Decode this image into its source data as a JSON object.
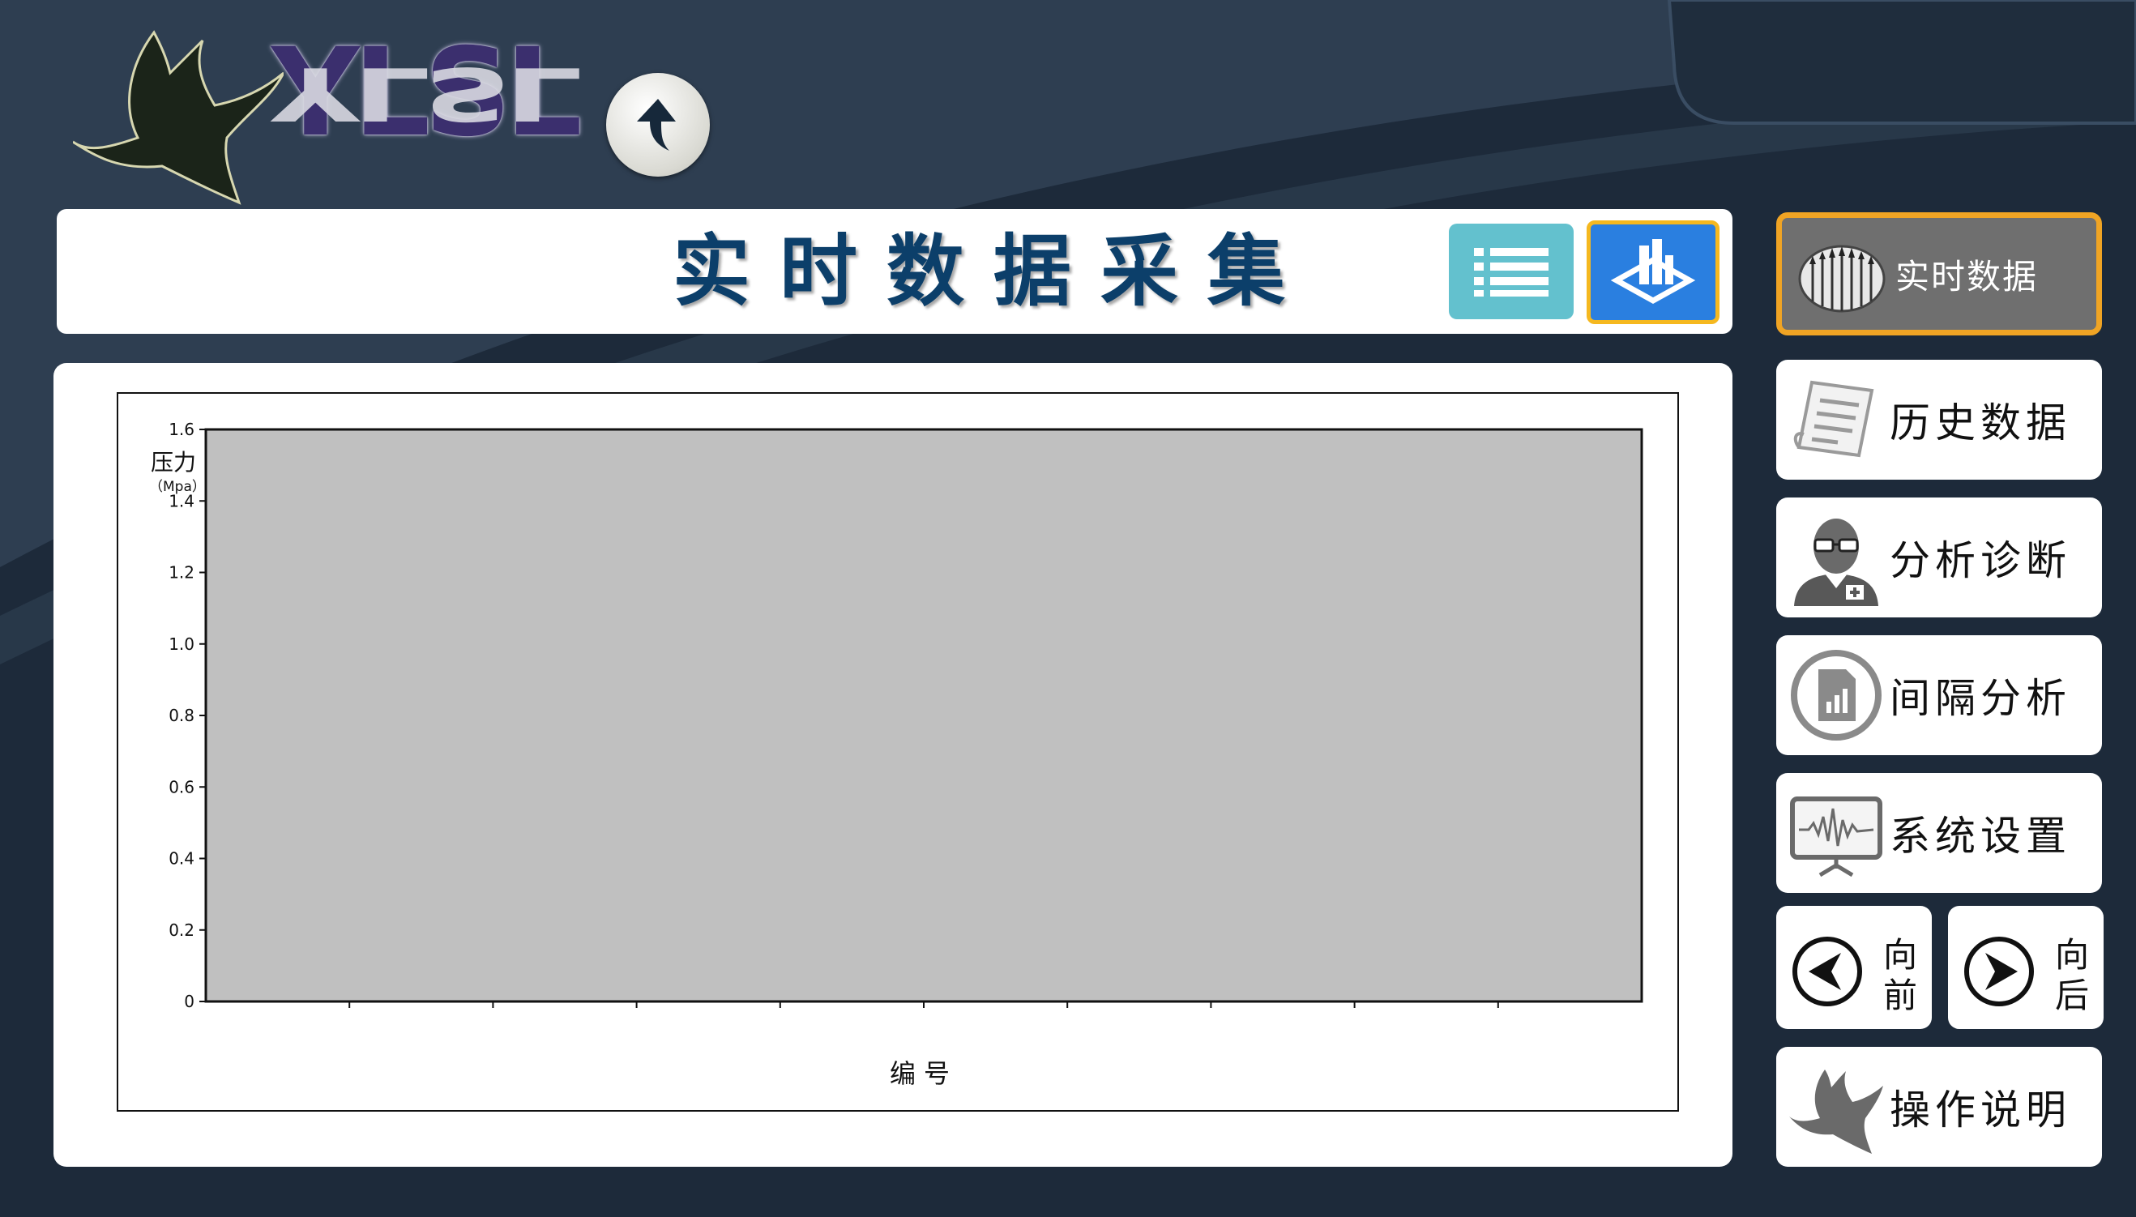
{
  "logo": {
    "text": "YLSL"
  },
  "header": {
    "title": "实时数据采集"
  },
  "toolbar": {
    "list_view_icon": "list-icon",
    "chart_view_icon": "chart-view-icon",
    "up_icon": "up-arrow-icon"
  },
  "sidebar": {
    "items": [
      {
        "label": "实时数据",
        "icon": "pencils-icon",
        "active": true
      },
      {
        "label": "历史数据",
        "icon": "document-icon"
      },
      {
        "label": "分析诊断",
        "icon": "doctor-icon"
      },
      {
        "label": "间隔分析",
        "icon": "report-chart-icon"
      },
      {
        "label": "系统设置",
        "icon": "waveform-monitor-icon"
      }
    ],
    "prev_label": "向前",
    "next_label": "向后",
    "help_label": "操作说明"
  },
  "colors": {
    "accent_active_border": "#f0a424",
    "chart_plot_bg": "#c0c0c0",
    "title_color": "#0c3f6a"
  },
  "chart_data": {
    "type": "line",
    "ylabel": "压力",
    "yunit": "（Mpa）",
    "xlabel": "编号",
    "ylim": [
      0,
      1.6
    ],
    "yticks": [
      "0",
      "0.2",
      "0.4",
      "0.6",
      "0.8",
      "1.0",
      "1.2",
      "1.4",
      "1.6"
    ],
    "x_tick_count": 10,
    "series": []
  }
}
